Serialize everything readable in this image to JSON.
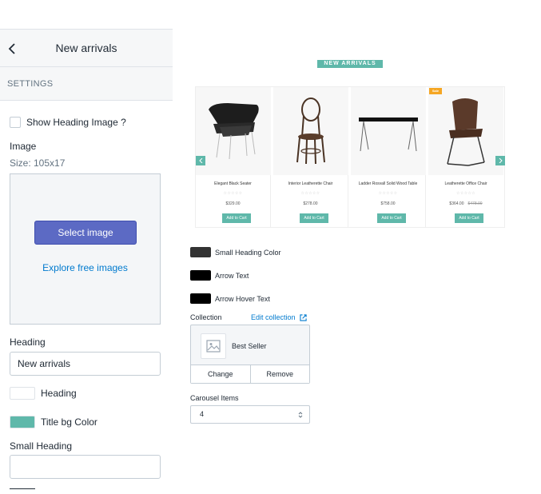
{
  "panel": {
    "title": "New arrivals",
    "section": "SETTINGS",
    "show_heading_image_label": "Show Heading Image ?",
    "image_label": "Image",
    "image_size": "Size: 105x17",
    "select_image": "Select image",
    "explore_images": "Explore free images",
    "heading_label": "Heading",
    "heading_value": "New arrivals",
    "heading_color_label": "Heading",
    "heading_color": "#ffffff",
    "title_bg_label": "Title bg Color",
    "title_bg_color": "#5fb8aa",
    "small_heading_label": "Small Heading",
    "small_heading_value": ""
  },
  "preview": {
    "banner": "NEW ARRIVALS",
    "products": [
      {
        "name": "Elegant Black Seater",
        "stars": "☆☆☆☆☆",
        "price": "$329.00",
        "old_price": "",
        "button": "Add to Cart",
        "badge": ""
      },
      {
        "name": "Interior Leatherette Chair",
        "stars": "☆☆☆☆☆",
        "price": "$278.00",
        "old_price": "",
        "button": "Add to Cart",
        "badge": ""
      },
      {
        "name": "Ladder Rosvall Solid Wood Table",
        "stars": "☆☆☆☆☆",
        "price": "$758.00",
        "old_price": "",
        "button": "Add to Cart",
        "badge": ""
      },
      {
        "name": "Leatherette Office Chair",
        "stars": "☆☆☆☆☆",
        "price": "$364.00",
        "old_price": "$478.00",
        "button": "Add to Cart",
        "badge": "Sale"
      }
    ]
  },
  "settings": {
    "small_heading_color_label": "Small Heading Color",
    "small_heading_color": "#333333",
    "arrow_text_label": "Arrow Text",
    "arrow_text_color": "#000000",
    "arrow_hover_label": "Arrow Hover Text",
    "arrow_hover_color": "#000000",
    "collection_label": "Collection",
    "edit_collection": "Edit collection",
    "collection_name": "Best Seller",
    "change": "Change",
    "remove": "Remove",
    "carousel_items_label": "Carousel Items",
    "carousel_items_value": "4"
  },
  "icons": {
    "back": "chevron-left-icon",
    "external": "external-link-icon",
    "image_placeholder": "image-placeholder-icon",
    "arrow_prev": "chevron-left-icon",
    "arrow_next": "chevron-right-icon",
    "select_caret": "select-caret-icon"
  }
}
